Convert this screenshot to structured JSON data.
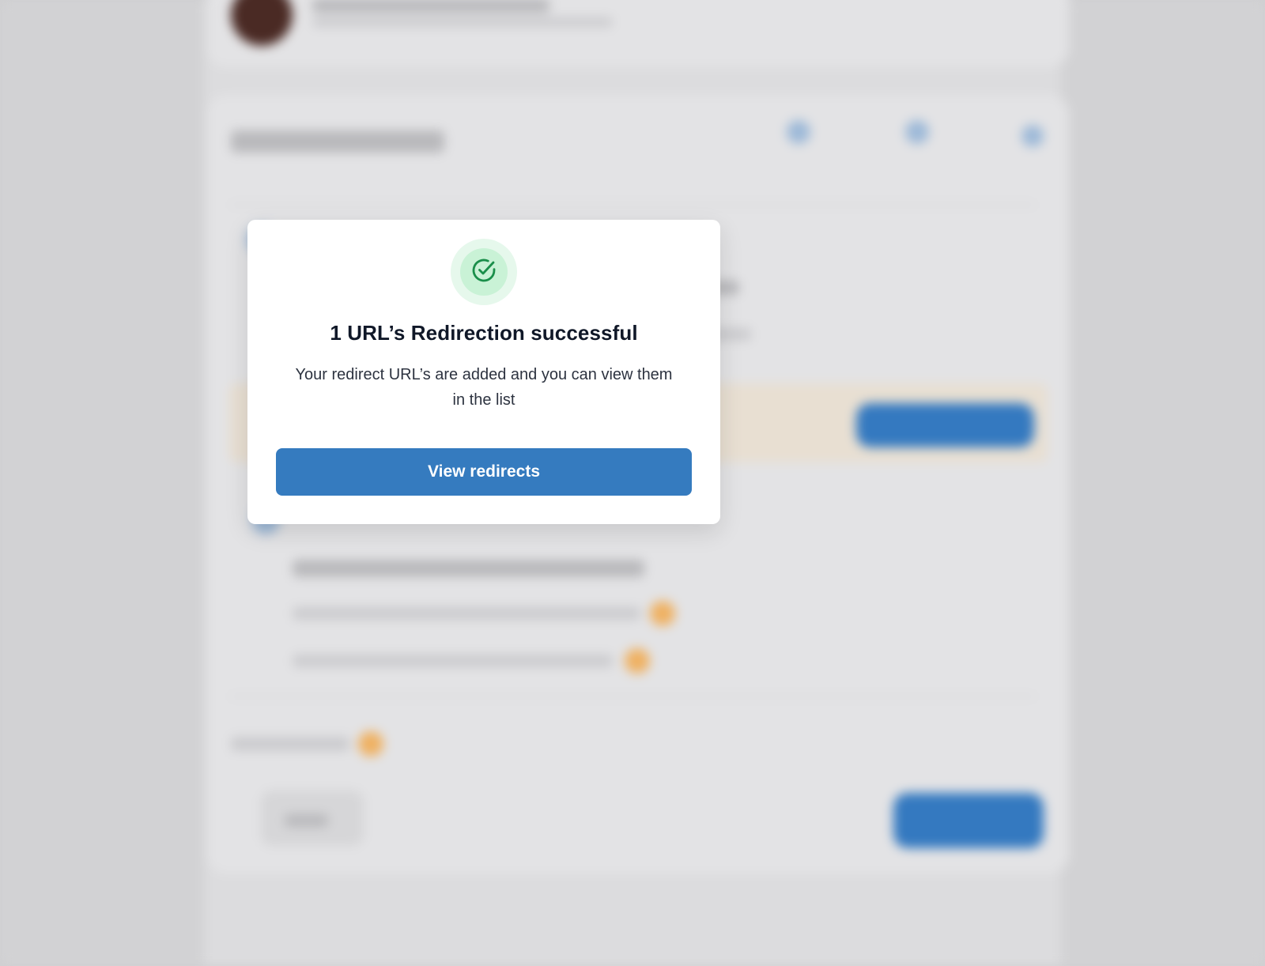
{
  "dialog": {
    "title": "1 URL’s Redirection successful",
    "message": "Your redirect URL’s are added and you can view them in the list",
    "primary_button_label": "View redirects",
    "icon": "check-circle-icon"
  },
  "colors": {
    "accent": "#357bbf",
    "success": "#1a8f4a",
    "success_ring_outer": "#e6f8ec",
    "success_ring_inner": "#c9f2d6",
    "title_text": "#101828",
    "body_text": "#2d3340"
  }
}
